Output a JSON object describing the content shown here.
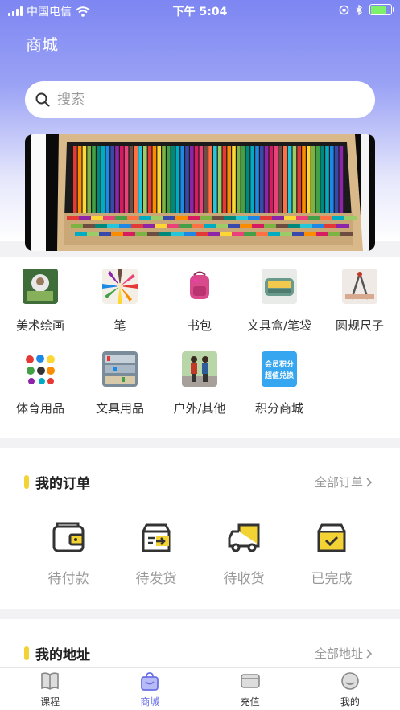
{
  "status_bar": {
    "carrier": "中国电信",
    "time": "下午 5:04",
    "battery_level": 0.85
  },
  "page": {
    "title": "商城"
  },
  "search": {
    "placeholder": "搜索"
  },
  "categories": [
    {
      "label": "美术绘画",
      "icon": "art-painting-thumb"
    },
    {
      "label": "笔",
      "icon": "colored-pencils-thumb"
    },
    {
      "label": "书包",
      "icon": "backpack-thumb"
    },
    {
      "label": "文具盒/笔袋",
      "icon": "pencil-case-thumb"
    },
    {
      "label": "圆规尺子",
      "icon": "compass-ruler-thumb"
    },
    {
      "label": "体育用品",
      "icon": "sports-goods-thumb"
    },
    {
      "label": "文具用品",
      "icon": "stationery-thumb"
    },
    {
      "label": "户外/其他",
      "icon": "outdoor-thumb"
    },
    {
      "label": "积分商城",
      "icon": "points-mall-thumb",
      "badge_text": "会员积分 超值兑换"
    }
  ],
  "orders": {
    "title": "我的订单",
    "link": "全部订单",
    "items": [
      {
        "label": "待付款",
        "icon": "wallet-icon"
      },
      {
        "label": "待发货",
        "icon": "ship-box-icon"
      },
      {
        "label": "待收货",
        "icon": "delivery-truck-icon"
      },
      {
        "label": "已完成",
        "icon": "done-box-icon"
      }
    ]
  },
  "address": {
    "title": "我的地址",
    "link": "全部地址"
  },
  "tabbar": {
    "items": [
      {
        "label": "课程",
        "icon": "course-book-icon"
      },
      {
        "label": "商城",
        "icon": "shop-bag-icon",
        "active": true
      },
      {
        "label": "充值",
        "icon": "card-icon"
      },
      {
        "label": "我的",
        "icon": "smile-face-icon"
      }
    ]
  },
  "colors": {
    "accent": "#6b70e6",
    "section_marker": "#f3d234",
    "header_gradient_top": "#7d86f2"
  }
}
